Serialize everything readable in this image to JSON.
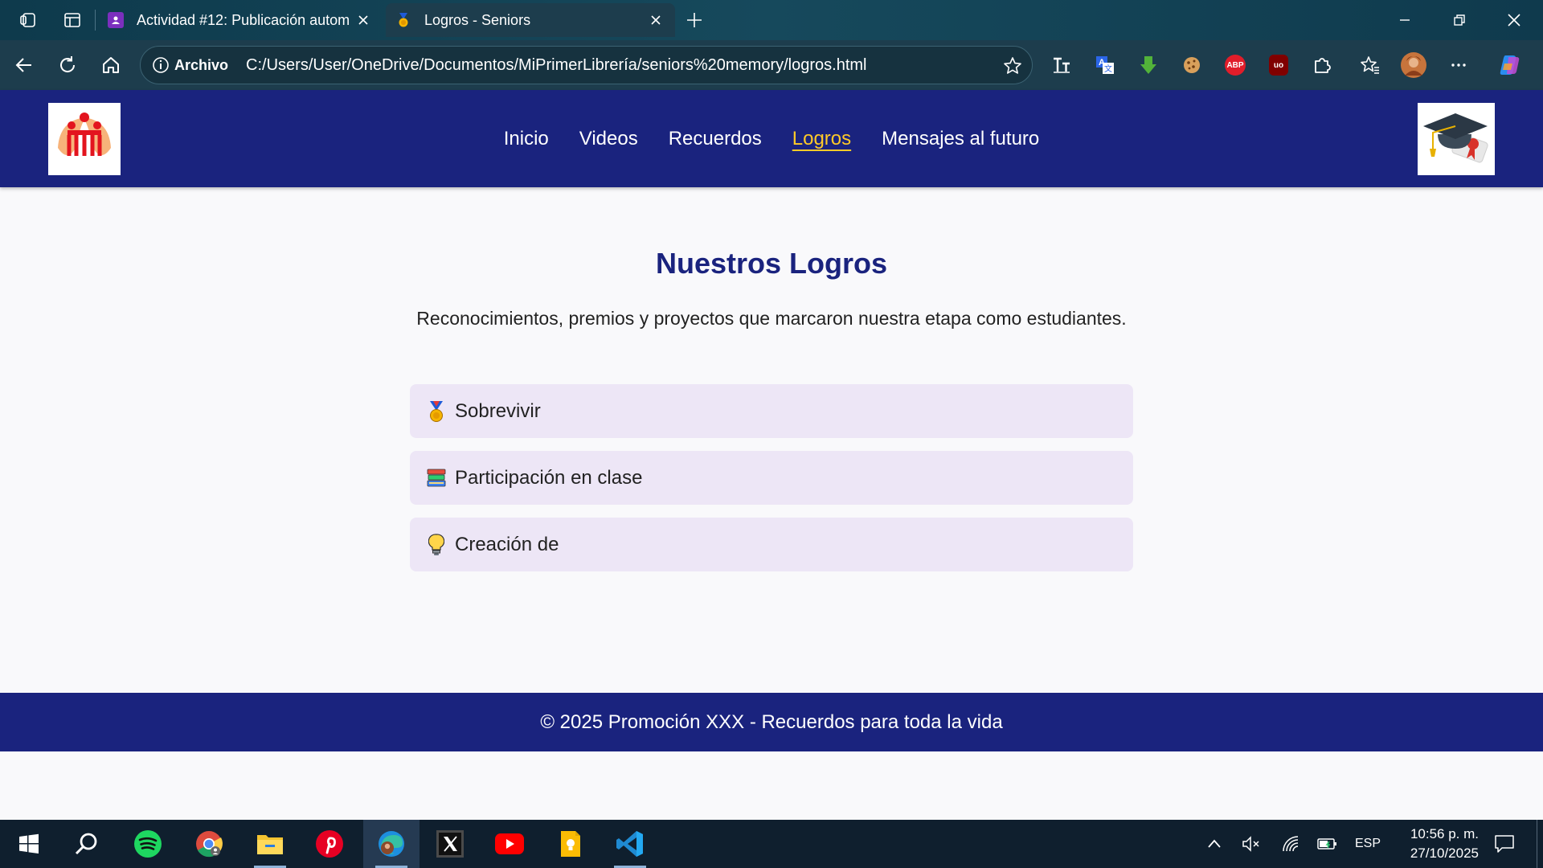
{
  "browser": {
    "tabs": [
      {
        "title": "Actividad #12: Publicación autom",
        "active": false,
        "favicon": "classroom-icon"
      },
      {
        "title": "Logros - Seniors",
        "active": true,
        "favicon": "medal-icon"
      }
    ],
    "address": {
      "site_label": "Archivo",
      "url": "C:/Users/User/OneDrive/Documentos/MiPrimerLibrería/seniors%20memory/logros.html"
    },
    "extensions": [
      "font-icon",
      "translate-icon",
      "download-arrow-icon",
      "cookie-icon",
      "adblock-plus-icon",
      "ublock-icon",
      "extensions-puzzle-icon",
      "favorites-icon",
      "profile-avatar",
      "more-icon",
      "copilot-icon"
    ],
    "extension_labels": {
      "adblock": "ABP",
      "ublock": "uo"
    }
  },
  "site": {
    "nav": [
      {
        "label": "Inicio",
        "active": false
      },
      {
        "label": "Videos",
        "active": false
      },
      {
        "label": "Recuerdos",
        "active": false
      },
      {
        "label": "Logros",
        "active": true
      },
      {
        "label": "Mensajes al futuro",
        "active": false
      }
    ],
    "colors": {
      "header": "#1a237e",
      "active_link": "#ffca28",
      "card": "#ede6f6"
    }
  },
  "main": {
    "title": "Nuestros Logros",
    "subtitle": "Reconocimientos, premios y proyectos que marcaron nuestra etapa como estudiantes.",
    "logros": [
      {
        "icon": "medal-icon",
        "label": "Sobrevivir"
      },
      {
        "icon": "books-icon",
        "label": "Participación en clase"
      },
      {
        "icon": "lightbulb-icon",
        "label": "Creación de"
      }
    ]
  },
  "footer": {
    "text": "© 2025 Promoción XXX - Recuerdos para toda la vida"
  },
  "taskbar": {
    "apps": [
      "windows-start-icon",
      "search-icon",
      "spotify-icon",
      "chrome-icon",
      "file-explorer-icon",
      "pinterest-icon",
      "edge-icon",
      "x-icon",
      "youtube-icon",
      "keep-icon",
      "vscode-icon"
    ],
    "language": "ESP",
    "time": "10:56 p. m.",
    "date": "27/10/2025"
  }
}
